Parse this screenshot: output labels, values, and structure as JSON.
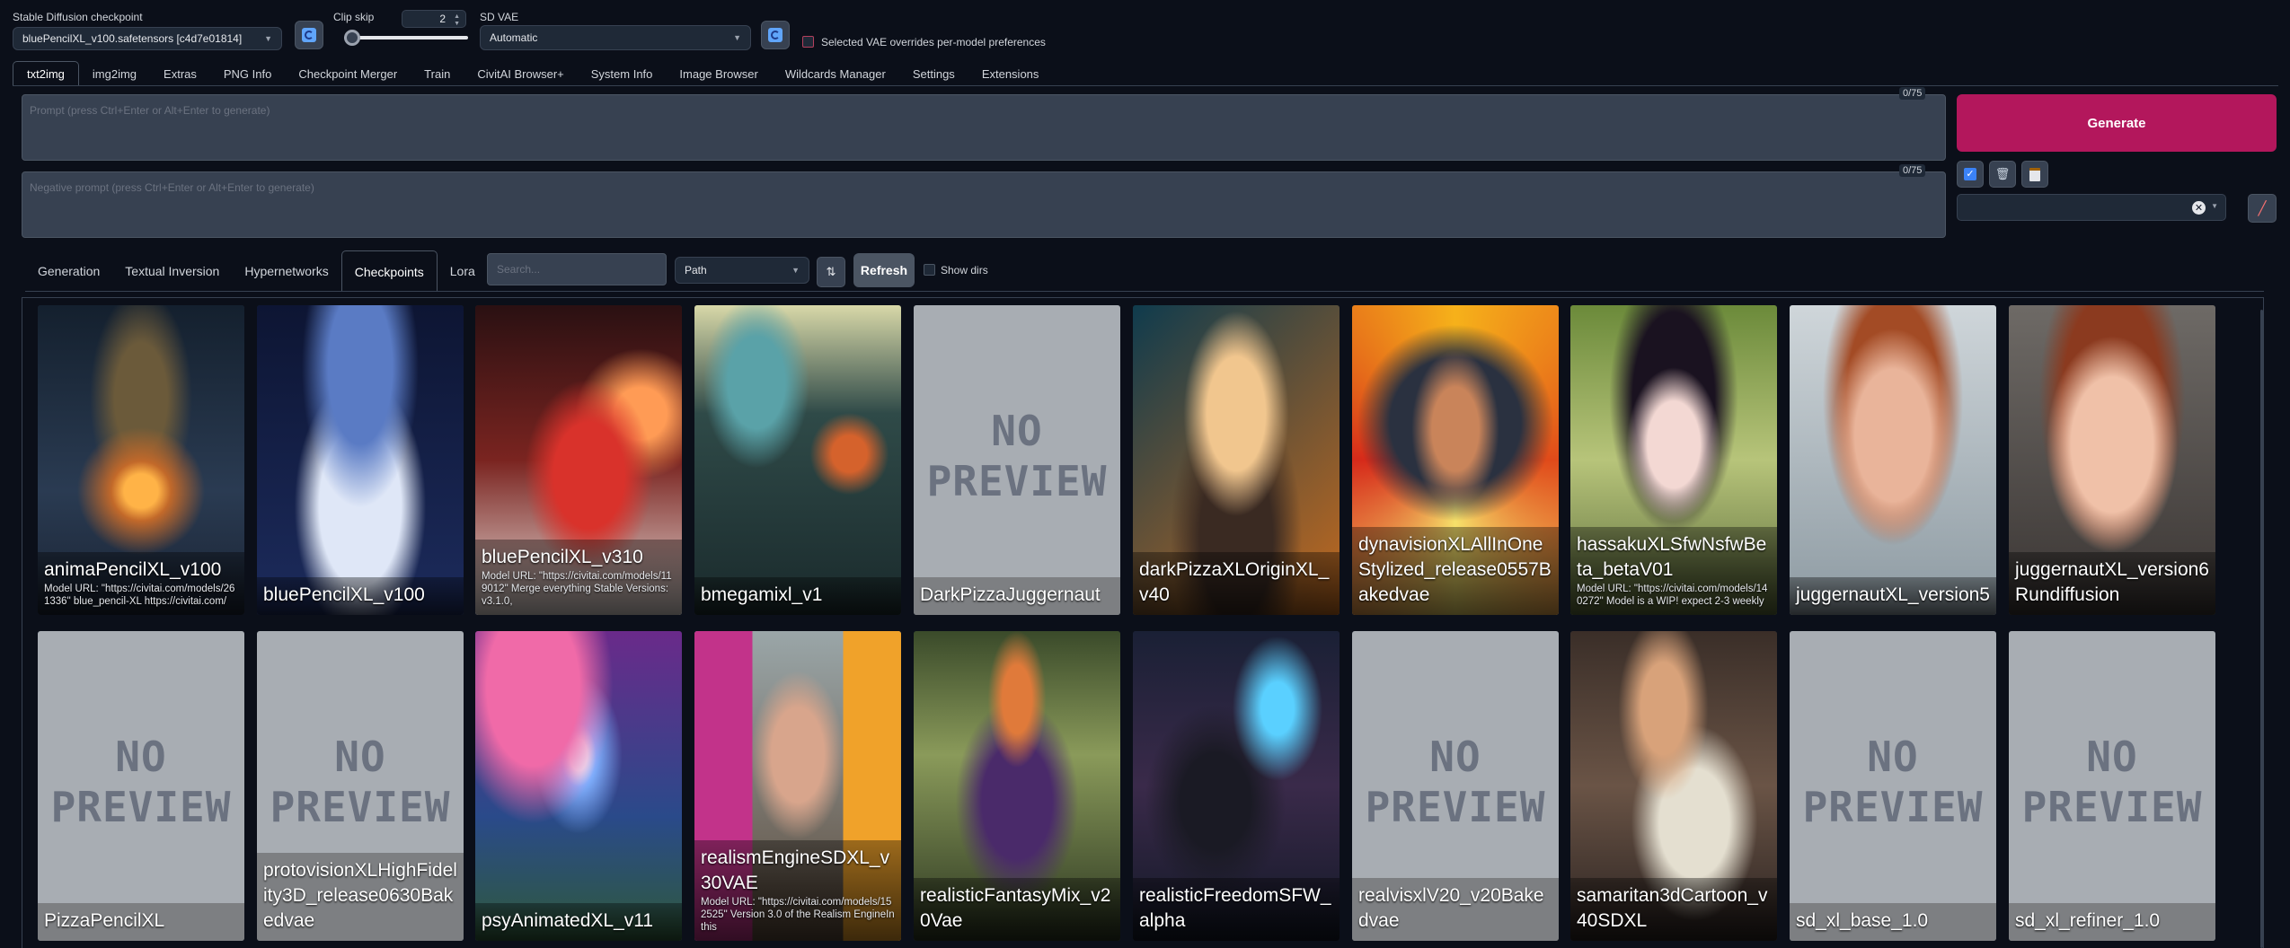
{
  "header": {
    "checkpoint_label": "Stable Diffusion checkpoint",
    "checkpoint_value": "bluePencilXL_v100.safetensors [c4d7e01814]",
    "clip_skip_label": "Clip skip",
    "clip_skip_value": "2",
    "vae_label": "SD VAE",
    "vae_value": "Automatic",
    "vae_override_label": "Selected VAE overrides per-model preferences"
  },
  "tabs": [
    "txt2img",
    "img2img",
    "Extras",
    "PNG Info",
    "Checkpoint Merger",
    "Train",
    "CivitAI Browser+",
    "System Info",
    "Image Browser",
    "Wildcards Manager",
    "Settings",
    "Extensions"
  ],
  "prompt": {
    "placeholder": "Prompt (press Ctrl+Enter or Alt+Enter to generate)",
    "counter": "0/75",
    "negative_placeholder": "Negative prompt (press Ctrl+Enter or Alt+Enter to generate)",
    "negative_counter": "0/75"
  },
  "actions": {
    "generate_label": "Generate",
    "check_icon": "checkbox-icon",
    "trash_icon": "trash-icon",
    "clipboard_icon": "clipboard-icon",
    "brush_icon": "paint-brush-icon"
  },
  "networks": {
    "tabs": [
      "Generation",
      "Textual Inversion",
      "Hypernetworks",
      "Checkpoints",
      "Lora"
    ],
    "search_placeholder": "Search...",
    "sort_value": "Path",
    "sort_icon": "sort-arrows-icon",
    "refresh_label": "Refresh",
    "show_dirs_label": "Show dirs",
    "no_preview_line1": "NO",
    "no_preview_line2": "PREVIEW"
  },
  "cards": [
    {
      "name": "animaPencilXL_v100",
      "desc": "Model URL: \"https://civitai.com/models/261336\" blue_pencil-XL https://civitai.com/",
      "preview": true
    },
    {
      "name": "bluePencilXL_v100",
      "desc": "",
      "preview": true
    },
    {
      "name": "bluePencilXL_v310",
      "desc": "Model URL: \"https://civitai.com/models/119012\" Merge everything Stable Versions: v3.1.0,",
      "preview": true
    },
    {
      "name": "bmegamixl_v1",
      "desc": "",
      "preview": true
    },
    {
      "name": "DarkPizzaJuggernaut",
      "desc": "",
      "preview": false
    },
    {
      "name": "darkPizzaXLOriginXL_v40",
      "desc": "",
      "preview": true
    },
    {
      "name": "dynavisionXLAllInOneStylized_release0557Bakedvae",
      "desc": "",
      "preview": true
    },
    {
      "name": "hassakuXLSfwNsfwBeta_betaV01",
      "desc": "Model URL: \"https://civitai.com/models/140272\" Model is a WIP! expect 2-3 weekly",
      "preview": true
    },
    {
      "name": "juggernautXL_version5",
      "desc": "",
      "preview": true
    },
    {
      "name": "juggernautXL_version6Rundiffusion",
      "desc": "",
      "preview": true
    },
    {
      "name": "PizzaPencilXL",
      "desc": "",
      "preview": false
    },
    {
      "name": "protovisionXLHighFidelity3D_release0630Bakedvae",
      "desc": "",
      "preview": false
    },
    {
      "name": "psyAnimatedXL_v11",
      "desc": "",
      "preview": true
    },
    {
      "name": "realismEngineSDXL_v30VAE",
      "desc": "Model URL: \"https://civitai.com/models/152525\" Version 3.0 of the Realism EngineIn this",
      "preview": true
    },
    {
      "name": "realisticFantasyMix_v20Vae",
      "desc": "",
      "preview": true
    },
    {
      "name": "realisticFreedomSFW_alpha",
      "desc": "",
      "preview": true
    },
    {
      "name": "realvisxlV20_v20Bakedvae",
      "desc": "",
      "preview": false
    },
    {
      "name": "samaritan3dCartoon_v40SDXL",
      "desc": "",
      "preview": true
    },
    {
      "name": "sd_xl_base_1.0",
      "desc": "",
      "preview": false
    },
    {
      "name": "sd_xl_refiner_1.0",
      "desc": "",
      "preview": false
    }
  ]
}
